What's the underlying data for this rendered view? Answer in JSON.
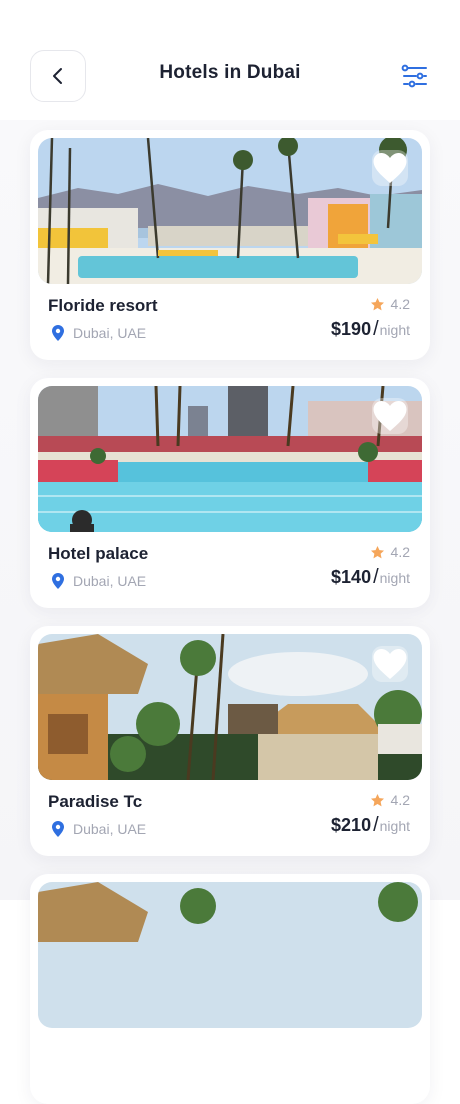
{
  "header": {
    "title": "Hotels in Dubai",
    "back_icon": "chevron-left-icon",
    "filter_icon": "sliders-icon"
  },
  "colors": {
    "accent": "#2f6fe0",
    "star": "#f5a65b",
    "text": "#1d2232",
    "muted": "#a3a6b3"
  },
  "hotels": [
    {
      "name": "Floride resort",
      "location": "Dubai, UAE",
      "rating": "4.2",
      "price": "$190",
      "unit": "night"
    },
    {
      "name": "Hotel palace",
      "location": "Dubai, UAE",
      "rating": "4.2",
      "price": "$140",
      "unit": "night"
    },
    {
      "name": "Paradise Tc",
      "location": "Dubai, UAE",
      "rating": "4.2",
      "price": "$210",
      "unit": "night"
    }
  ]
}
